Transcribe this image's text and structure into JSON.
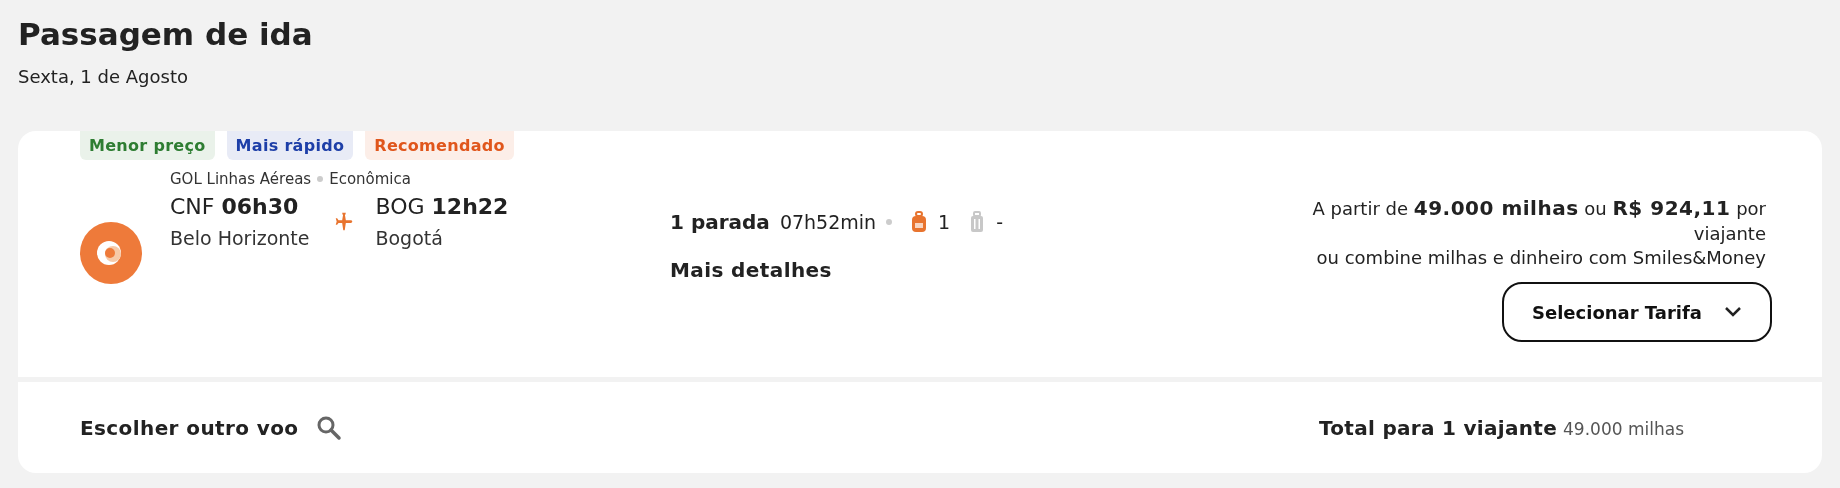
{
  "header": {
    "title": "Passagem de ida",
    "date": "Sexta, 1 de Agosto"
  },
  "flight": {
    "badges": [
      {
        "label": "Menor preço",
        "color": "#2e7d32"
      },
      {
        "label": "Mais rápido",
        "color": "#1e3fa8"
      },
      {
        "label": "Recomendado",
        "color": "#e0561c"
      }
    ],
    "airline": "GOL Linhas Aéreas",
    "cabin": "Econômica",
    "departure": {
      "code": "CNF",
      "time": "06h30",
      "city": "Belo Horizonte"
    },
    "arrival": {
      "code": "BOG",
      "time": "12h22",
      "city": "Bogotá"
    },
    "stops": "1 parada",
    "duration": "07h52min",
    "baggage": [
      {
        "kind": "carry_on",
        "included": true,
        "count": "1"
      },
      {
        "kind": "checked",
        "included": false,
        "count": "-"
      }
    ],
    "details_link": "Mais detalhes",
    "price_text": "A partir de **49.000 milhas** ou **R$ 924,11** por viajante",
    "combine_text": "ou combine milhas e dinheiro com Smiles&Money",
    "select_button": "Selecionar Tarifa"
  },
  "footer": {
    "other_flight": "Escolher outro voo",
    "total_label": "Total para 1 viajante",
    "total_value": "49.000 milhas"
  }
}
